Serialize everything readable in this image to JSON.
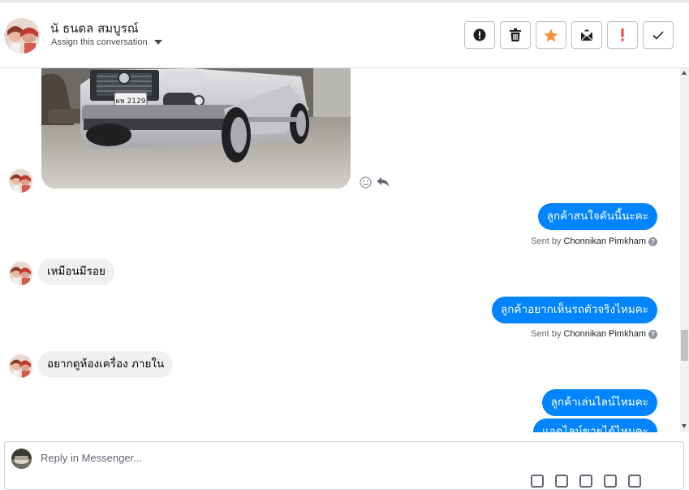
{
  "header": {
    "contact_name": "นั ธนดล สมบูรณ์",
    "assign_label": "Assign this conversation",
    "toolbar": [
      {
        "name": "spam",
        "icon": "alert-circle-icon"
      },
      {
        "name": "delete",
        "icon": "trash-icon"
      },
      {
        "name": "star",
        "icon": "star-icon",
        "color": "#f7923b"
      },
      {
        "name": "mark-unread",
        "icon": "envelope-icon"
      },
      {
        "name": "follow-up",
        "icon": "exclamation-icon",
        "color": "#fa3e3e"
      },
      {
        "name": "done",
        "icon": "checkmark-icon"
      }
    ]
  },
  "thread": {
    "photo": {
      "plate": "ผห 2129"
    },
    "messages": [
      {
        "direction": "out",
        "text": "ลูกค้าสนใจคันนี้นะคะ",
        "sent_by_label": "Sent by",
        "agent": "Chonnikan Pimkham"
      },
      {
        "direction": "in",
        "text": "เหมือนมีรอย"
      },
      {
        "direction": "out",
        "text": "ลูกค้าอยากเห็นรถตัวจริงไหมคะ",
        "sent_by_label": "Sent by",
        "agent": "Chonnikan Pimkham"
      },
      {
        "direction": "in",
        "text": "อยากดูห้องเครื่อง ภายใน"
      },
      {
        "direction": "out",
        "text": "ลูกค้าเล่นไลน์ไหมคะ"
      },
      {
        "direction": "out",
        "text": "แอดไลน์ขายได้ไหมคะ"
      }
    ],
    "help_glyph": "?"
  },
  "reply": {
    "placeholder": "Reply in Messenger..."
  },
  "colors": {
    "accent": "#0084ff",
    "incoming_bubble": "#f0f0f0",
    "star": "#f7923b",
    "alert": "#fa3e3e"
  }
}
